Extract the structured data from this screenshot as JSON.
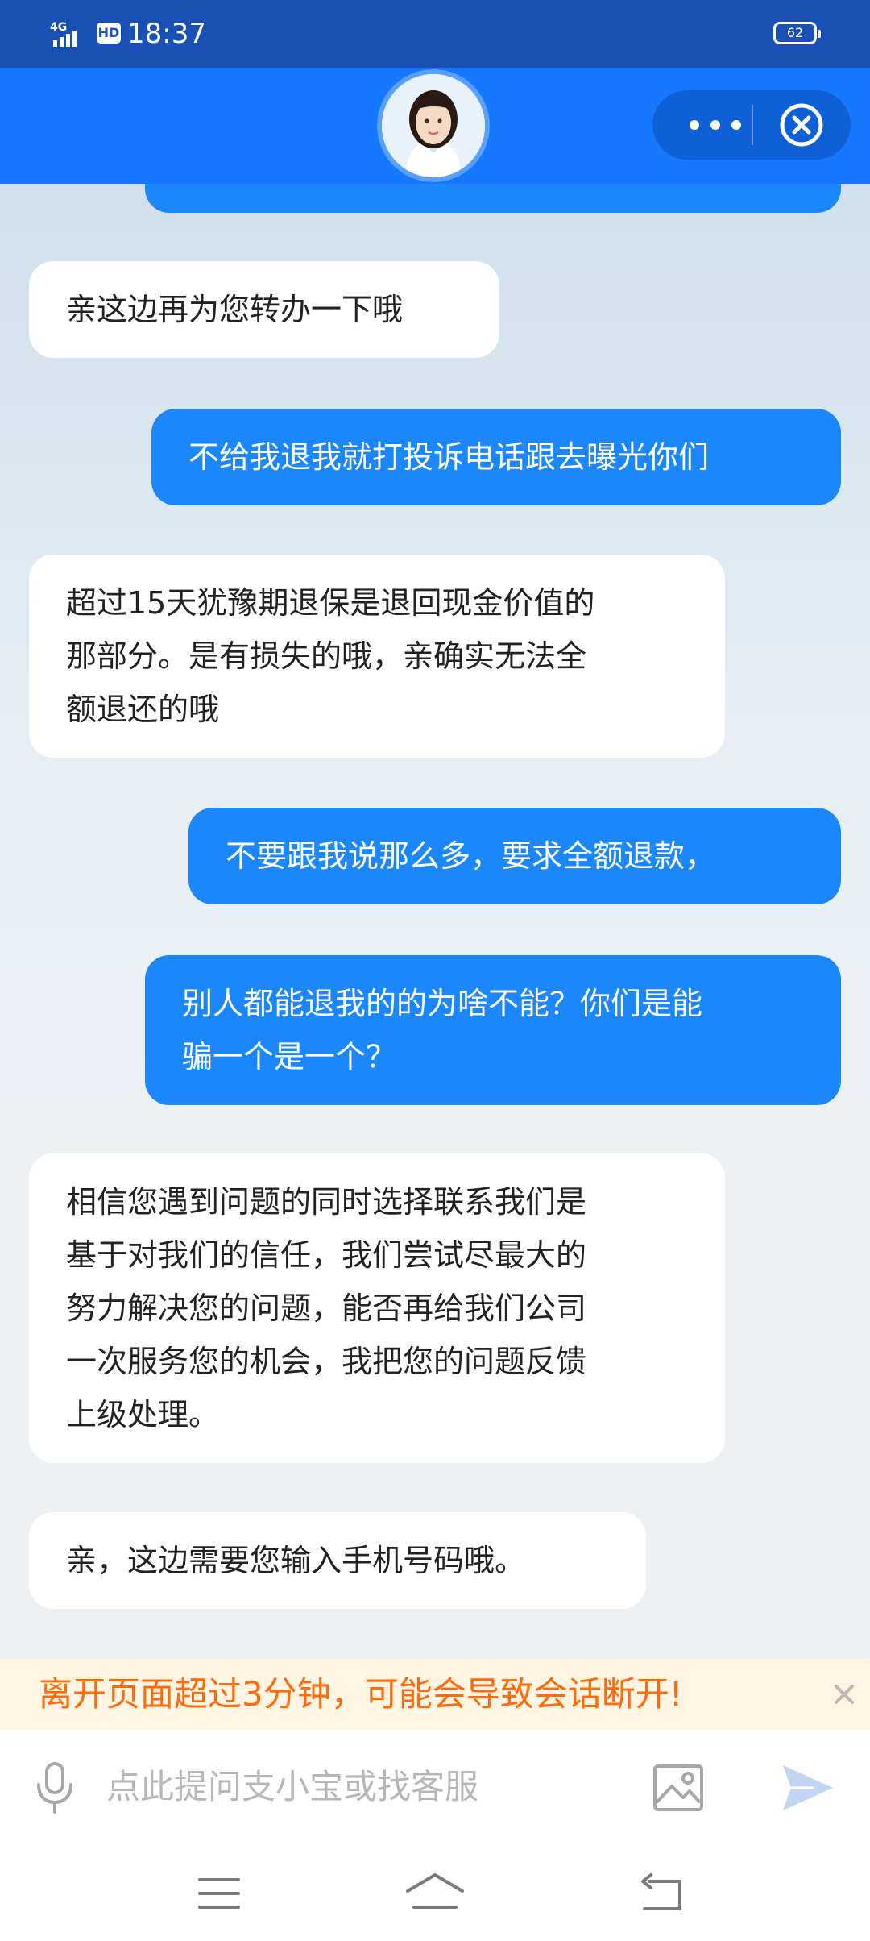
{
  "status_bar": {
    "network": "4G",
    "hd": "HD",
    "time": "18:37",
    "battery": "62"
  },
  "header": {
    "avatar_icon": "agent-avatar",
    "more_icon": "more-dots-icon",
    "close_icon": "close-circle-icon"
  },
  "messages": [
    {
      "side": "in",
      "lines": [
        "亲这边再为您转办一下哦"
      ]
    },
    {
      "side": "out",
      "lines": [
        "不给我退我就打投诉电话跟去曝光你们"
      ]
    },
    {
      "side": "in",
      "lines": [
        "超过15天犹豫期退保是退回现金价值的",
        "那部分。是有损失的哦，亲确实无法全",
        "额退还的哦"
      ]
    },
    {
      "side": "out",
      "lines": [
        "不要跟我说那么多，要求全额退款，"
      ]
    },
    {
      "side": "out",
      "lines": [
        "别人都能退我的的为啥不能？你们是能",
        "骗一个是一个？"
      ]
    },
    {
      "side": "in",
      "lines": [
        "相信您遇到问题的同时选择联系我们是",
        "基于对我们的信任，我们尝试尽最大的",
        "努力解决您的问题，能否再给我们公司",
        "一次服务您的机会，我把您的问题反馈",
        "上级处理。"
      ]
    },
    {
      "side": "in",
      "lines": [
        "亲，这边需要您输入手机号码哦。"
      ]
    }
  ],
  "notice": {
    "text": "离开页面超过3分钟，可能会导致会话断开!"
  },
  "input": {
    "placeholder": "点此提问支小宝或找客服",
    "value": ""
  },
  "colors": {
    "header": "#1677ff",
    "statusbar": "#1a4fb3",
    "outgoing_bubble": "#1b87fb",
    "incoming_bubble": "#ffffff",
    "notice_text": "#ff6a0c",
    "notice_bg": "#fff5e2"
  }
}
